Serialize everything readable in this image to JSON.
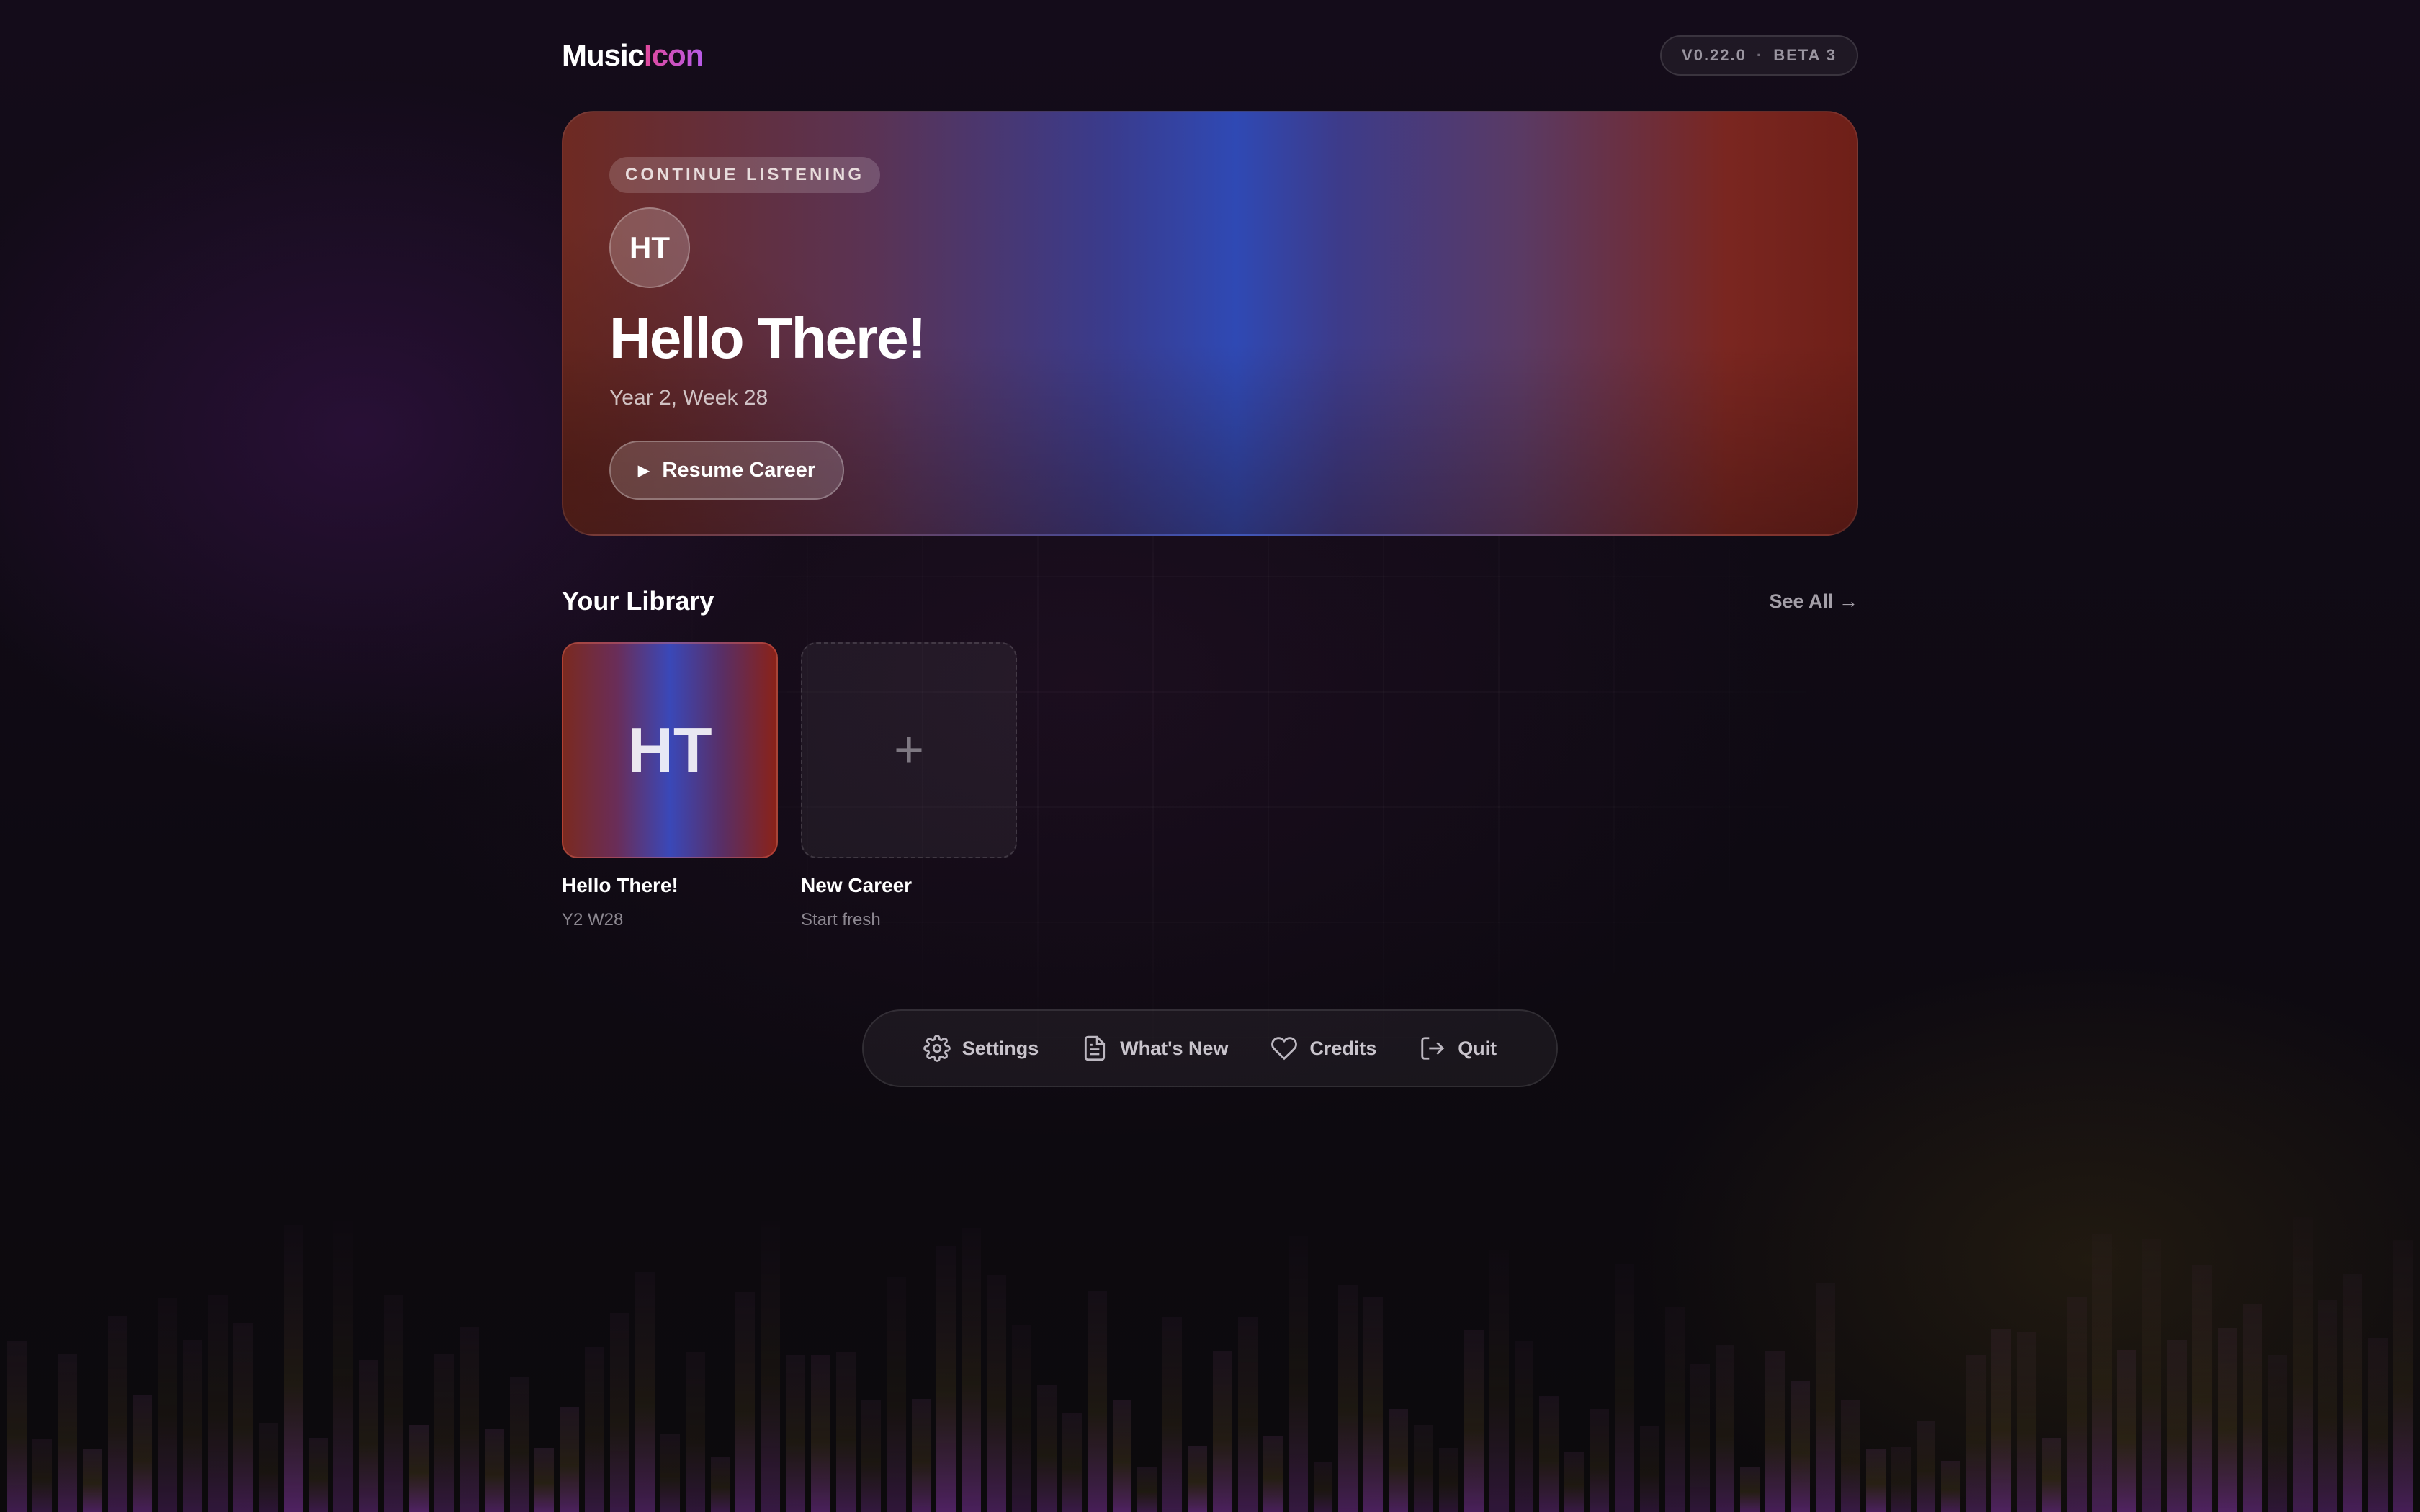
{
  "app": {
    "logo_primary": "Music",
    "logo_accent": "Icon",
    "version": "V0.22.0",
    "version_separator": "·",
    "build": "BETA 3"
  },
  "hero": {
    "pill_label": "CONTINUE LISTENING",
    "avatar_initials": "HT",
    "title": "Hello There!",
    "subtitle": "Year 2, Week 28",
    "resume_label": "Resume Career",
    "play_glyph": "▶"
  },
  "library": {
    "title": "Your Library",
    "see_all_label": "See All →",
    "items": [
      {
        "thumb_text": "HT",
        "title": "Hello There!",
        "subtitle": "Y2 W28"
      },
      {
        "thumb_text": "+",
        "title": "New Career",
        "subtitle": "Start fresh"
      }
    ]
  },
  "footer_nav": {
    "items": [
      {
        "label": "Settings",
        "icon": "gear-icon"
      },
      {
        "label": "What's New",
        "icon": "document-icon"
      },
      {
        "label": "Credits",
        "icon": "heart-icon"
      },
      {
        "label": "Quit",
        "icon": "logout-icon"
      }
    ]
  },
  "colors": {
    "logo_accent": "#e0489a",
    "hero_blue": "#2f49b4",
    "hero_red": "#7a2620",
    "background": "#0d0a10"
  }
}
